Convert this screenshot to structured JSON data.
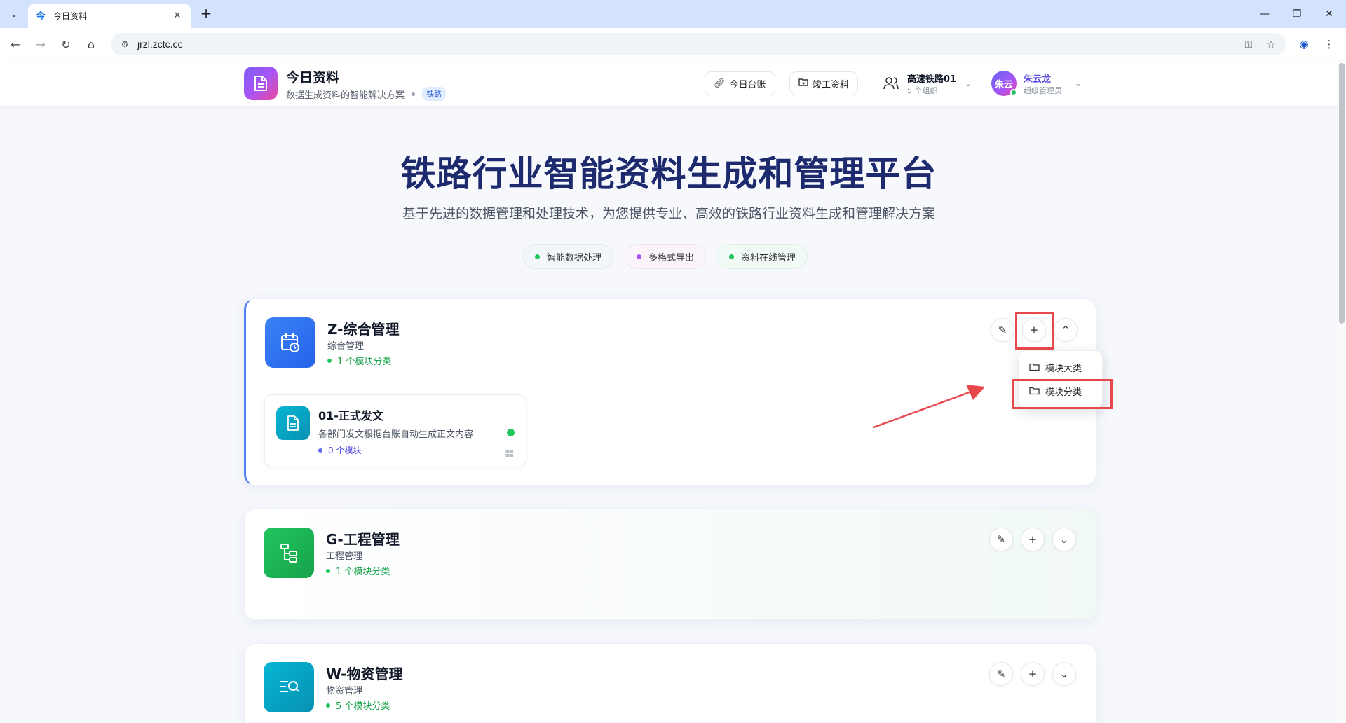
{
  "browser": {
    "tab_title": "今日资料",
    "tab_favicon": "今",
    "url": "jrzl.zctc.cc"
  },
  "header": {
    "app_name": "今日资料",
    "tagline": "数据生成资料的智能解决方案",
    "badge": "铁路",
    "buttons": [
      {
        "label": "今日台账",
        "icon": "link-icon"
      },
      {
        "label": "竣工资料",
        "icon": "folder-check-icon"
      }
    ],
    "org": {
      "name": "高速铁路01",
      "count": "5 个组织"
    },
    "user": {
      "avatar": "朱云",
      "name": "朱云龙",
      "role": "超级管理员"
    }
  },
  "hero": {
    "title": "铁路行业智能资料生成和管理平台",
    "subtitle": "基于先进的数据管理和处理技术，为您提供专业、高效的铁路行业资料生成和管理解决方案",
    "chips": [
      {
        "label": "智能数据处理",
        "color": "#22c55e"
      },
      {
        "label": "多格式导出",
        "color": "#a855f7"
      },
      {
        "label": "资料在线管理",
        "color": "#22c55e"
      }
    ]
  },
  "categories": [
    {
      "title": "Z-综合管理",
      "subtitle": "综合管理",
      "count": "1 个模块分类",
      "expanded": true,
      "children": [
        {
          "title": "01-正式发文",
          "desc": "各部门发文根据台账自动生成正文内容",
          "count": "0 个模块"
        }
      ]
    },
    {
      "title": "G-工程管理",
      "subtitle": "工程管理",
      "count": "1 个模块分类",
      "expanded": false
    },
    {
      "title": "W-物资管理",
      "subtitle": "物资管理",
      "count": "5 个模块分类",
      "expanded": false
    }
  ],
  "dropdown": {
    "items": [
      "模块大类",
      "模块分类"
    ]
  },
  "colors": {
    "accent": "#4f80ef",
    "highlight": "#e8474c",
    "success": "#22c55e"
  }
}
